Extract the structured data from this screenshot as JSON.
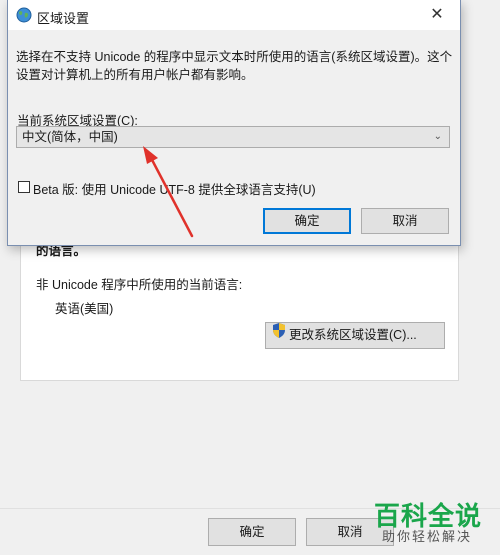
{
  "background_window": {
    "partial_text": "的语言。",
    "non_unicode_label": "非 Unicode 程序中所使用的当前语言:",
    "current_language": "英语(美国)",
    "change_locale_button": "更改系统区域设置(C)...",
    "ok_button": "确定",
    "cancel_button": "取消"
  },
  "dialog": {
    "title": "区域设置",
    "description_line1": "选择在不支持 Unicode 的程序中显示文本时所使用的语言(系统区域设置)。这个",
    "description_line2": "设置对计算机上的所有用户帐户都有影响。",
    "current_locale_label": "当前系统区域设置(C):",
    "current_locale_value": "中文(简体，中国)",
    "beta_checkbox_label": "Beta 版: 使用 Unicode UTF-8 提供全球语言支持(U)",
    "beta_checked": false,
    "ok_button": "确定",
    "cancel_button": "取消",
    "close_glyph": "✕"
  },
  "annotation": {
    "color": "#e0322b"
  },
  "watermark": {
    "logo_text": "百科全说",
    "sub_text": "助你轻松解决"
  }
}
